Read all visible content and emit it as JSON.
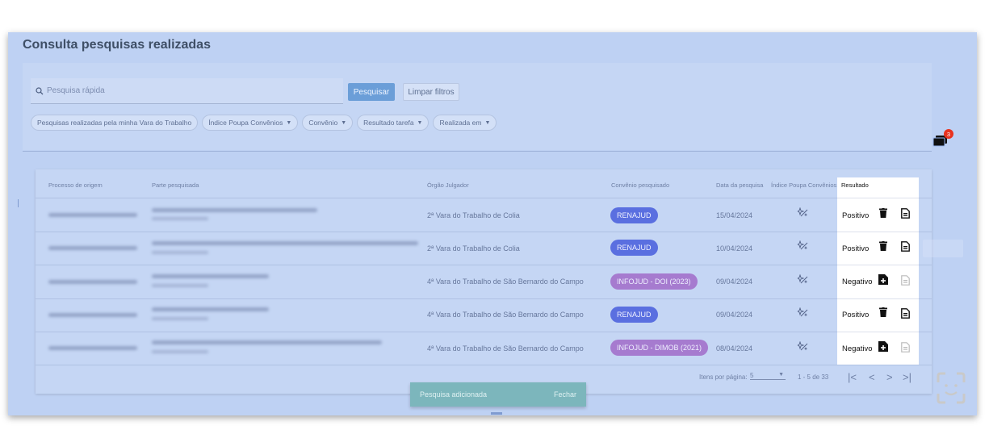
{
  "page": {
    "title": "Consulta pesquisas realizadas"
  },
  "search": {
    "placeholder": "Pesquisa rápida",
    "submit_label": "Pesquisar",
    "clear_label": "Limpar filtros"
  },
  "filters": {
    "chips": [
      {
        "label": "Pesquisas realizadas pela minha Vara do Trabalho",
        "has_caret": false
      },
      {
        "label": "Índice Poupa Convênios",
        "has_caret": true
      },
      {
        "label": "Convênio",
        "has_caret": true
      },
      {
        "label": "Resultado tarefa",
        "has_caret": true
      },
      {
        "label": "Realizada em",
        "has_caret": true
      }
    ]
  },
  "notifications": {
    "count": "3"
  },
  "table": {
    "headers": {
      "processo": "Processo de origem",
      "parte": "Parte pesquisada",
      "orgao": "Órgão Julgador",
      "convenio": "Convênio pesquisado",
      "data": "Data da pesquisa",
      "indice": "Índice Poupa Convênios",
      "resultado": "Resultado"
    },
    "rows": [
      {
        "orgao": "2ª Vara do Trabalho de Colia",
        "convenio": "RENAJUD",
        "convenio_color": "blue",
        "data": "15/04/2024",
        "resultado": "Positivo"
      },
      {
        "orgao": "2ª Vara do Trabalho de Colia",
        "convenio": "RENAJUD",
        "convenio_color": "blue",
        "data": "10/04/2024",
        "resultado": "Positivo"
      },
      {
        "orgao": "4ª Vara do Trabalho de São Bernardo do Campo",
        "convenio": "INFOJUD - DOI (2023)",
        "convenio_color": "purple",
        "data": "09/04/2024",
        "resultado": "Negativo"
      },
      {
        "orgao": "4ª Vara do Trabalho de São Bernardo do Campo",
        "convenio": "RENAJUD",
        "convenio_color": "blue",
        "data": "09/04/2024",
        "resultado": "Positivo"
      },
      {
        "orgao": "4ª Vara do Trabalho de São Bernardo do Campo",
        "convenio": "INFOJUD - DIMOB (2021)",
        "convenio_color": "purple",
        "data": "08/04/2024",
        "resultado": "Negativo"
      }
    ]
  },
  "paginator": {
    "items_label": "Itens por página:",
    "page_size": "5",
    "range_label": "1 - 5 de 33"
  },
  "snackbar": {
    "message": "Pesquisa adicionada",
    "action": "Fechar"
  },
  "colors": {
    "overlay": "#96b4eb",
    "primary_button": "#6b9ed8",
    "pill_blue": "#5a6fe0",
    "pill_purple": "#a67bcf",
    "badge": "#e8321f",
    "snackbar": "#7cb6bc"
  },
  "icons": {
    "search": "search-icon",
    "notifications": "folders-icon",
    "indice": "sparkle-icon",
    "delete": "trash-icon",
    "document": "document-icon",
    "add_document": "file-plus-icon",
    "assistant": "face-scan-icon"
  }
}
